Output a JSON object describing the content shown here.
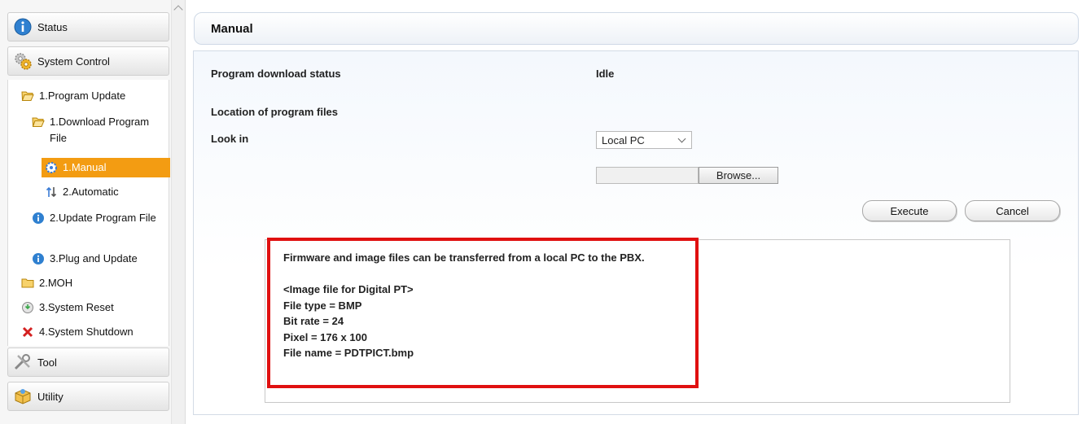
{
  "sidebar": {
    "categories": {
      "status": "Status",
      "system_control": "System Control",
      "tool": "Tool",
      "utility": "Utility"
    },
    "tree": {
      "program_update": "1.Program Update",
      "download_program_file": "1.Download Program File",
      "manual": "1.Manual",
      "automatic": "2.Automatic",
      "update_program_file": "2.Update Program File",
      "plug_and_update": "3.Plug and Update",
      "moh": "2.MOH",
      "system_reset": "3.System Reset",
      "system_shutdown": "4.System Shutdown"
    }
  },
  "main": {
    "title": "Manual",
    "download_status_label": "Program download status",
    "download_status_value": "Idle",
    "location_label": "Location of program files",
    "look_in_label": "Look in",
    "look_in_value": "Local PC",
    "file_path_value": "",
    "browse_label": "Browse...",
    "execute_label": "Execute",
    "cancel_label": "Cancel",
    "note": {
      "line1": "Firmware and image files can be transferred from a local PC to the PBX.",
      "line2": "<Image file for Digital PT>",
      "line3": "File type = BMP",
      "line4": "Bit rate = 24",
      "line5": "Pixel = 176 x 100",
      "line6": "File name = PDTPICT.bmp"
    }
  },
  "colors": {
    "selected_item": "#f39c12",
    "highlight_border": "#e01010",
    "info_icon": "#2f80d0"
  }
}
